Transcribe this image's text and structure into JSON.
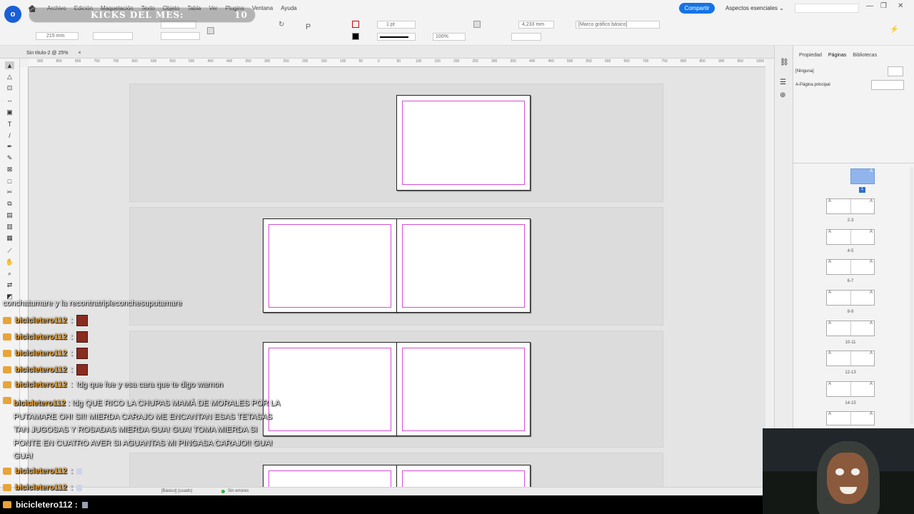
{
  "menubar": {
    "logo_letter": "o",
    "items": [
      "Archivo",
      "Edición",
      "Maquetación",
      "Texto",
      "Objeto",
      "Tabla",
      "Ver",
      "Plugins",
      "Ventana",
      "Ayuda"
    ],
    "overlay_text": "KICKS DEL MES:",
    "overlay_count": "10",
    "share_label": "Compartir",
    "workspace_label": "Aspectos esenciales"
  },
  "controlbar": {
    "w_value": "215 mm",
    "stroke_weight": "1 pt",
    "zoom_pct": "100%",
    "dimension": "4,233 mm",
    "style_select": "[Marco gráfico básico]"
  },
  "document": {
    "tab_title": "Sin título-2 @ 25%",
    "close_glyph": "×"
  },
  "ruler": {
    "ticks": [
      "900",
      "850",
      "800",
      "750",
      "700",
      "650",
      "600",
      "550",
      "500",
      "450",
      "400",
      "350",
      "300",
      "250",
      "200",
      "150",
      "100",
      "50",
      "0",
      "50",
      "100",
      "150",
      "200",
      "250",
      "300",
      "350",
      "400",
      "450",
      "500",
      "550",
      "600",
      "650",
      "700",
      "750",
      "800",
      "850",
      "900",
      "950",
      "1000"
    ]
  },
  "rightpanel": {
    "tabs": [
      "Propiedad",
      "Páginas",
      "Bibliotecas"
    ],
    "active_tab": "Páginas",
    "master_none": "[Ninguna]",
    "master_a": "A-Página principal",
    "page_one_label": "1",
    "spread_master_letter": "A",
    "spreads": [
      "2-3",
      "4-5",
      "6-7",
      "8-9",
      "10-11",
      "12-13",
      "14-15"
    ]
  },
  "statusbar": {
    "style": "[Básico] (usado)",
    "errors": "Sin errores"
  },
  "chat": {
    "first_line": "conchatumare y la recontratripleconchesuputamare",
    "username": "bicicletero112",
    "separator": ":",
    "msg_warnon": "!dg que fue y esa cara que te digo warnon",
    "msg_long": "!dg QUE RICO LA CHUPAS MAMÁ DE MORALES POR LA PUTAMARE OH! SI!! MIERDA CARAJO ME ENCANTAN ESAS TETASAS TAN JUGOSAS Y ROSADAS MIERDA GUA! GUA! TOMA MIERDA SI PONTE EN CUATRO AVER SI AGUANTAS MI PINGASA CARAJO!! GUA! GUA!",
    "bottom_user": "bicicletero112 :"
  },
  "colors": {
    "accent": "#1473e6",
    "margin_guide": "#d64fd6",
    "chat_name": "#e8a43a",
    "page_selected": "#8fb5ec"
  }
}
